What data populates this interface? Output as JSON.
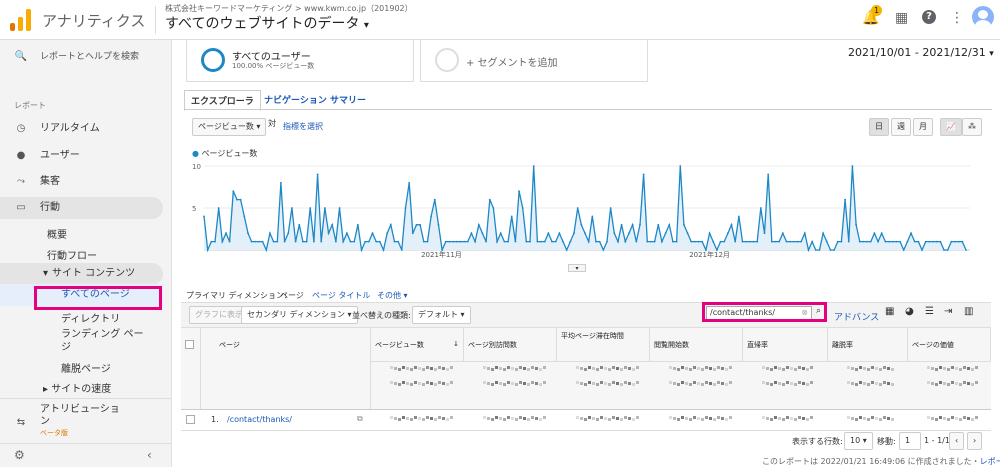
{
  "header": {
    "app_title": "アナリティクス",
    "account": "株式会社キーワードマーケティング > www.kwm.co.jp（201902）",
    "view": "すべてのウェブサイトのデータ",
    "badge": "1"
  },
  "sidebar": {
    "search": "レポートとヘルプを検索",
    "section": "レポート",
    "items": [
      "リアルタイム",
      "ユーザー",
      "集客",
      "行動"
    ],
    "behavior_sub": [
      "概要",
      "行動フロー"
    ],
    "site_content": "サイト コンテンツ",
    "site_content_sub": [
      "すべてのページ",
      "ディレクトリ",
      "ランディング ページ",
      "離脱ページ"
    ],
    "site_speed": "サイトの速度",
    "attribution": "アトリビューション",
    "beta": "ベータ版"
  },
  "segments": {
    "all_users": "すべてのユーザー",
    "all_users_sub": "100.00% ページビュー数",
    "add": "+ セグメントを追加"
  },
  "date_range": "2021/10/01 - 2021/12/31",
  "tabs": [
    "エクスプローラ",
    "ナビゲーション サマリー"
  ],
  "chart_controls": {
    "metric": "ページビュー数",
    "compare": "対",
    "select_metric": "指標を選択",
    "periods": [
      "日",
      "週",
      "月"
    ]
  },
  "chart_data": {
    "type": "line",
    "series": [
      {
        "name": "ページビュー数",
        "values": [
          4,
          0,
          1,
          1,
          5,
          1,
          2,
          1,
          7,
          6,
          6,
          4,
          2,
          1,
          1,
          1,
          1,
          0,
          2,
          1,
          1,
          8,
          1,
          2,
          5,
          1,
          3,
          1,
          1,
          5,
          1,
          9,
          1,
          5,
          2,
          3,
          1,
          5,
          1,
          2,
          1,
          1,
          3,
          0,
          1,
          1,
          2,
          1,
          1,
          0,
          2,
          3,
          1,
          1,
          0,
          5,
          8,
          2,
          3,
          3,
          1,
          1,
          4,
          6,
          3,
          0,
          1,
          1,
          1,
          1,
          1,
          1,
          1,
          2,
          1,
          3,
          2,
          1,
          6,
          5,
          1,
          2,
          1,
          1,
          4,
          1,
          7,
          5,
          1,
          1,
          10,
          1,
          1,
          1,
          2,
          1,
          1,
          2,
          1,
          0,
          1,
          2,
          5,
          3,
          2,
          1,
          4,
          1,
          1,
          0,
          1,
          5,
          2,
          1,
          3,
          1,
          2,
          3,
          1,
          3,
          9,
          1,
          1,
          1,
          3,
          1,
          2,
          3,
          1,
          1,
          10,
          3,
          2,
          1,
          1,
          1,
          1,
          0,
          2,
          1,
          0,
          1,
          1,
          2,
          3,
          1,
          4,
          1,
          1,
          1,
          1,
          1,
          5,
          2,
          9,
          1,
          1,
          1,
          2,
          1,
          1,
          1,
          1,
          1,
          2,
          0,
          1,
          0,
          0,
          2,
          1,
          0,
          0,
          1,
          1,
          6,
          1,
          10,
          3,
          1,
          1,
          1,
          1,
          2,
          1,
          2,
          1,
          1,
          1,
          1,
          1,
          0,
          1,
          2,
          1,
          1,
          0,
          1,
          1,
          1,
          1,
          1,
          0,
          0,
          1,
          1,
          1,
          1,
          0
        ]
      }
    ],
    "yticks": [
      "10",
      "5"
    ],
    "xticks": [
      "2021年11月",
      "2021年12月"
    ],
    "ylim": [
      0,
      10
    ]
  },
  "dimension": {
    "label": "プライマリ ディメンション:",
    "page": "ページ",
    "page_title": "ページ タイトル",
    "other": "その他"
  },
  "toolbar": {
    "graph": "グラフに表示",
    "secondary": "セカンダリ ディメンション",
    "sort_type": "並べ替えの種類:",
    "default": "デフォルト",
    "filter_value": "/contact/thanks/",
    "advance": "アドバンス"
  },
  "table": {
    "headers": [
      "ページ",
      "ページビュー数",
      "ページ別訪問数",
      "平均ページ滞在時間",
      "閲覧開始数",
      "直帰率",
      "離脱率",
      "ページの価値"
    ],
    "row": {
      "num": "1.",
      "page": "/contact/thanks/"
    }
  },
  "footer": {
    "rows_label": "表示する行数:",
    "rows": "10",
    "goto": "移動:",
    "goto_val": "1",
    "range": "1 - 1/1",
    "created": "このレポートは 2022/01/21 16:49:06 に作成されました・",
    "refresh": "レポートを更新"
  }
}
